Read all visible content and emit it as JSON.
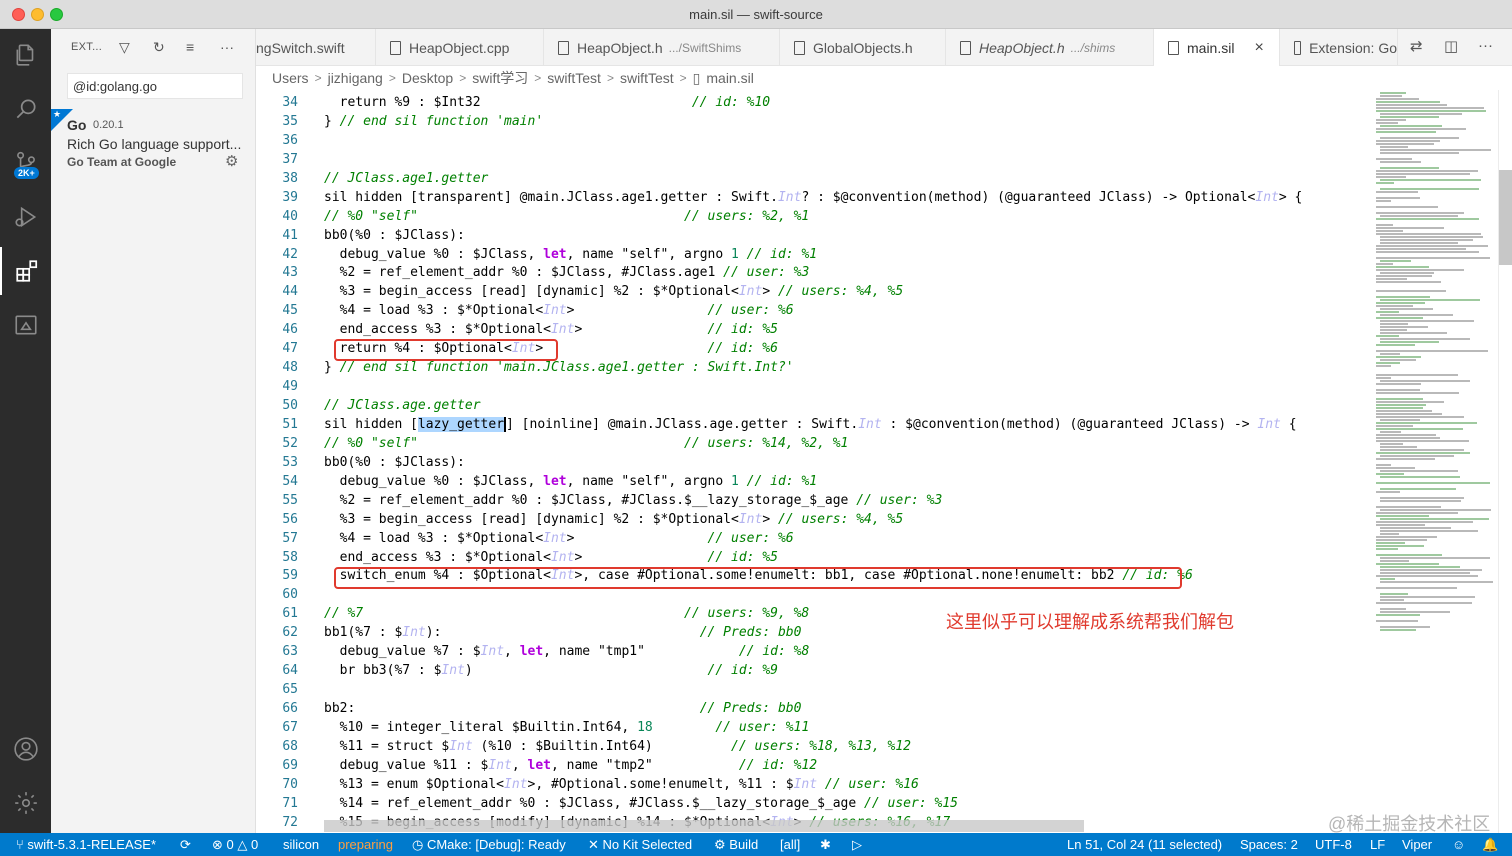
{
  "window": {
    "title": "main.sil — swift-source"
  },
  "colors": {
    "accent": "#007acc",
    "annotation": "#e03a2e",
    "sidebar_bg": "#f3f3f3",
    "activity_bg": "#2c2c2c"
  },
  "activity_bar": {
    "icons": [
      "explorer-icon",
      "search-icon",
      "source-control-icon",
      "run-debug-icon",
      "extensions-icon",
      "remote-explorer-icon",
      "account-icon",
      "settings-gear-icon"
    ],
    "source_control_badge": "2K+"
  },
  "sidebar": {
    "title": "EXT...",
    "search_value": "@id:golang.go",
    "extension": {
      "name": "Go",
      "version": "0.20.1",
      "description": "Rich Go language support...",
      "publisher": "Go Team at Google"
    }
  },
  "tabs": [
    {
      "label": "ngSwitch.swift",
      "desc": "",
      "italic": false
    },
    {
      "label": "HeapObject.cpp",
      "desc": "",
      "italic": false
    },
    {
      "label": "HeapObject.h",
      "desc": ".../SwiftShims",
      "italic": false
    },
    {
      "label": "GlobalObjects.h",
      "desc": "",
      "italic": false
    },
    {
      "label": "HeapObject.h",
      "desc": ".../shims",
      "italic": true
    },
    {
      "label": "main.sil",
      "desc": "",
      "italic": false,
      "active": true
    },
    {
      "label": "Extension: Go",
      "desc": "",
      "italic": false
    }
  ],
  "breadcrumb": [
    "Users",
    "jizhigang",
    "Desktop",
    "swift学习",
    "swiftTest",
    "swiftTest",
    "main.sil"
  ],
  "editor": {
    "line_numbers": [
      "34",
      "35",
      "36",
      "37",
      "38",
      "39",
      "40",
      "41",
      "42",
      "43",
      "44",
      "45",
      "46",
      "47",
      "48",
      "49",
      "50",
      "51",
      "52",
      "53",
      "54",
      "55",
      "56",
      "57",
      "58",
      "59",
      "60",
      "61",
      "62",
      "63",
      "64",
      "65",
      "66",
      "67",
      "68",
      "69",
      "70",
      "71",
      "72"
    ],
    "annotation": "这里似乎可以理解成系统帮我们解包"
  },
  "status_bar": {
    "branch": "swift-5.3.1-RELEASE*",
    "errors": "0",
    "warnings": "0",
    "platform": "silicon",
    "state": "preparing",
    "cmake": "CMake: [Debug]: Ready",
    "kit": "No Kit Selected",
    "build": "Build",
    "target": "[all]",
    "position": "Ln 51, Col 24 (11 selected)",
    "spaces": "Spaces: 2",
    "encoding": "UTF-8",
    "eol": "LF",
    "mode": "Viper"
  },
  "watermark": "@稀土掘金技术社区"
}
